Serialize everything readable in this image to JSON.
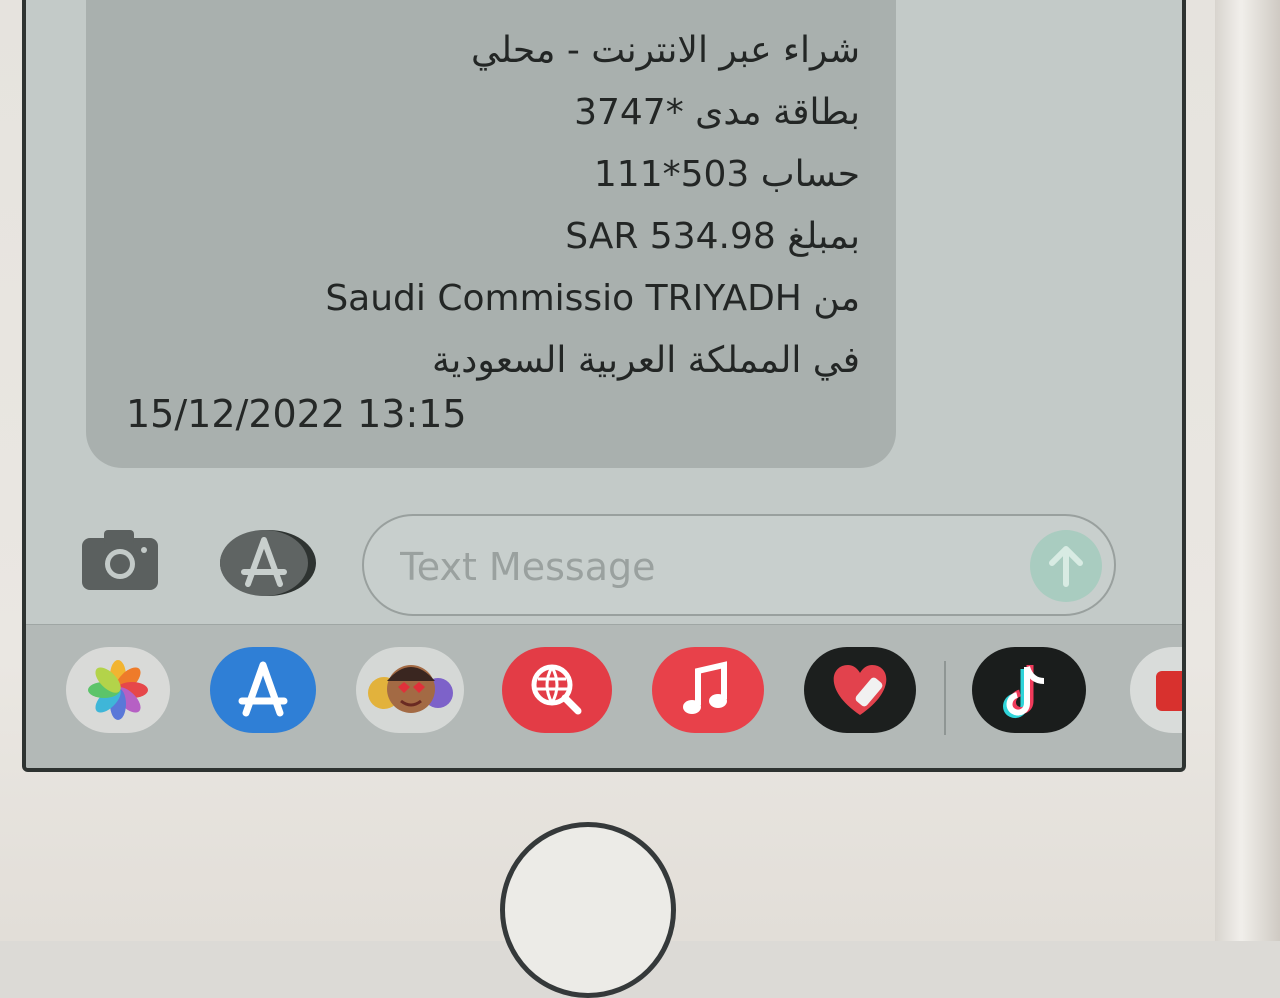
{
  "message": {
    "lines": [
      "شراء عبر الانترنت - محلي",
      "بطاقة مدى *3747",
      "حساب 503*111",
      "بمبلغ SAR 534.98",
      "من Saudi Commissio TRIYADH",
      "في المملكة العربية السعودية"
    ],
    "timestamp": "15/12/2022 13:15"
  },
  "compose": {
    "placeholder": "Text Message"
  },
  "drawer": {
    "apps": [
      {
        "icon": "photos-icon",
        "color": "#d9dad8"
      },
      {
        "icon": "app-store-icon",
        "color": "#2f7fd6"
      },
      {
        "icon": "memoji-icon",
        "color": "#d5d8d6"
      },
      {
        "icon": "images-search-icon",
        "color": "#e33c46"
      },
      {
        "icon": "music-icon",
        "color": "#e8414a"
      },
      {
        "icon": "fitness-heart-icon",
        "color": "#1c1f1e"
      },
      {
        "icon": "tiktok-icon",
        "color": "#1a1d1c"
      },
      {
        "icon": "partial-app-icon",
        "color": "#d8312e"
      }
    ]
  },
  "colors": {
    "screen_bg": "#c3cac8",
    "bubble_bg": "#a9b0ae",
    "send_button": "#a9ccc0"
  }
}
